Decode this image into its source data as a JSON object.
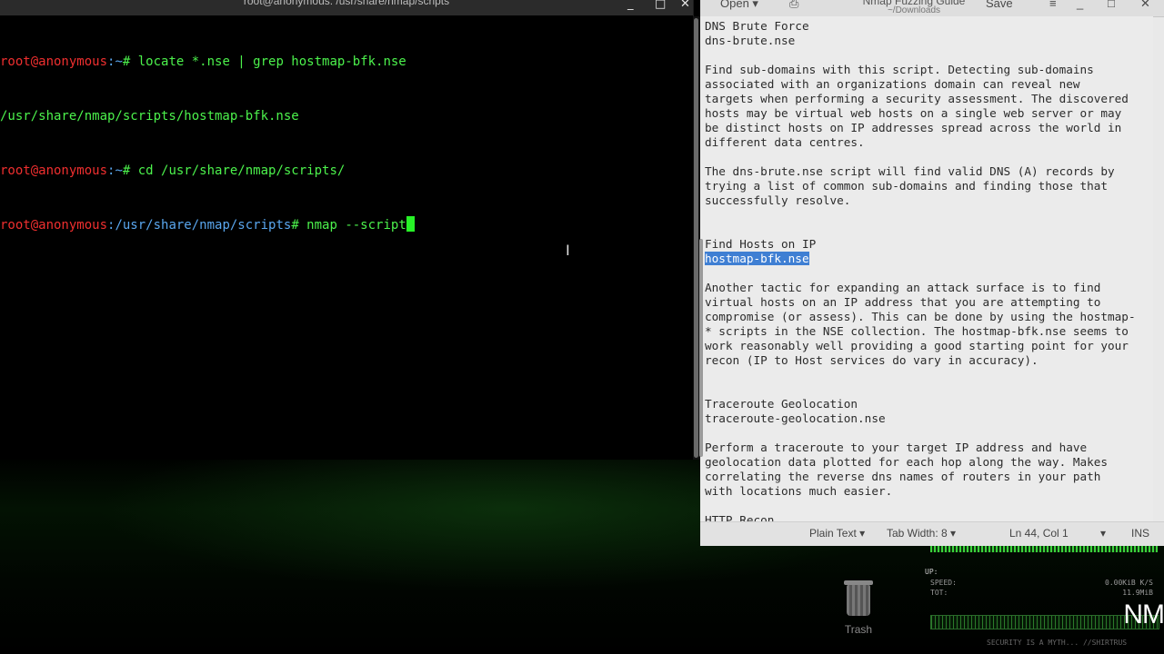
{
  "terminal": {
    "title": "root@anonymous: /usr/share/nmap/scripts",
    "lines": [
      {
        "user": "root@anonymous",
        "path": ":~",
        "sym": "# ",
        "cmd": "locate *.nse | grep hostmap-bfk.nse"
      },
      {
        "output": "/usr/share/nmap/scripts/hostmap-bfk.nse"
      },
      {
        "user": "root@anonymous",
        "path": ":~",
        "sym": "# ",
        "cmd": "cd /usr/share/nmap/scripts/"
      },
      {
        "user": "root@anonymous",
        "path": ":/usr/share/nmap/scripts",
        "sym": "# ",
        "cmd": "nmap --script"
      }
    ],
    "controls": {
      "minimize": "_",
      "maximize": "□",
      "close": "✕"
    }
  },
  "editor": {
    "open_label": "Open ▾",
    "title": "Nmap Fuzzing Guide",
    "subtitle": "~/Downloads",
    "save_label": "Save",
    "menu_icon": "≡",
    "controls": {
      "minimize": "_",
      "maximize": "□",
      "close": "✕"
    },
    "content": {
      "l1": "DNS Brute Force",
      "l2": "dns-brute.nse",
      "l3": "Find sub-domains with this script. Detecting sub-domains",
      "l4": "associated with an organizations domain can reveal new",
      "l5": "targets when performing a security assessment. The discovered",
      "l6": "hosts may be virtual web hosts on a single web server or may",
      "l7": "be distinct hosts on IP addresses spread across the world in",
      "l8": "different data centres.",
      "l9": "The dns-brute.nse script will find valid DNS (A) records by",
      "l10": "trying a list of common sub-domains and finding those that",
      "l11": "successfully resolve.",
      "l12": "Find Hosts on IP",
      "l13": "hostmap-bfk.nse",
      "l14": "Another tactic for expanding an attack surface is to find",
      "l15": "virtual hosts on an IP address that you are attempting to",
      "l16": "compromise (or assess). This can be done by using the hostmap-",
      "l17": "* scripts in the NSE collection. The hostmap-bfk.nse seems to",
      "l18": "work reasonably well providing a good starting point for your",
      "l19": "recon (IP to Host services do vary in accuracy).",
      "l20": "Traceroute Geolocation",
      "l21": "traceroute-geolocation.nse",
      "l22": "Perform a traceroute to your target IP address and have",
      "l23": "geolocation data plotted for each hop along the way. Makes",
      "l24": "correlating the reverse dns names of routers in your path",
      "l25": "with locations much easier.",
      "l26": "HTTP Recon"
    },
    "status": {
      "language": "Plain Text ▾",
      "tab_width": "Tab Width: 8 ▾",
      "position": "Ln 44, Col 1",
      "dropdown": "▾",
      "mode": "INS"
    }
  },
  "desktop": {
    "trash_label": "Trash",
    "conky": {
      "up": "UP:",
      "speed": "SPEED:",
      "tot": "TOT:",
      "speed_val": "0.00KiB K/S",
      "tot_val": "11.9MiB",
      "footer": "SECURITY IS A MYTH... //SHIRTRUS"
    },
    "watermark": "NM"
  }
}
